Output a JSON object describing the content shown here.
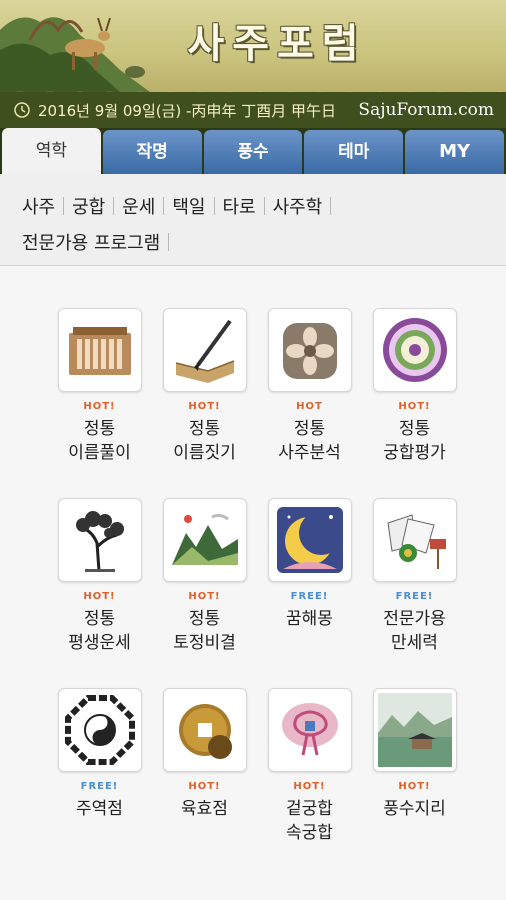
{
  "banner": {
    "title": "사주포럼"
  },
  "datebar": {
    "date": "2016년 9월 09일(금) -丙申年 丁酉月 甲午日",
    "site": "SajuForum.com"
  },
  "tabs": [
    {
      "label": "역학",
      "active": true
    },
    {
      "label": "작명",
      "active": false
    },
    {
      "label": "풍수",
      "active": false
    },
    {
      "label": "테마",
      "active": false
    },
    {
      "label": "MY",
      "active": false
    }
  ],
  "submenu": {
    "row1": [
      "사주",
      "궁합",
      "운세",
      "택일",
      "타로",
      "사주학"
    ],
    "row2": [
      "전문가용 프로그램"
    ]
  },
  "grid": [
    {
      "icon": "name-tablet-icon",
      "badge": "HOT!",
      "badge_type": "hot",
      "line1": "정통",
      "line2": "이름풀이"
    },
    {
      "icon": "brush-book-icon",
      "badge": "HOT!",
      "badge_type": "hot",
      "line1": "정통",
      "line2": "이름짓기"
    },
    {
      "icon": "flower-seal-icon",
      "badge": "HOT",
      "badge_type": "hot",
      "line1": "정통",
      "line2": "사주분석"
    },
    {
      "icon": "mandala-icon",
      "badge": "HOT!",
      "badge_type": "hot",
      "line1": "정통",
      "line2": "궁합평가"
    },
    {
      "icon": "tree-icon",
      "badge": "HOT!",
      "badge_type": "hot",
      "line1": "정통",
      "line2": "평생운세"
    },
    {
      "icon": "mountain-landscape-icon",
      "badge": "HOT!",
      "badge_type": "hot",
      "line1": "정통",
      "line2": "토정비결"
    },
    {
      "icon": "moon-icon",
      "badge": "FREE!",
      "badge_type": "free",
      "line1": "꿈해몽",
      "line2": ""
    },
    {
      "icon": "fans-icon",
      "badge": "FREE!",
      "badge_type": "free",
      "line1": "전문가용",
      "line2": "만세력"
    },
    {
      "icon": "bagua-icon",
      "badge": "FREE!",
      "badge_type": "free",
      "line1": "주역점",
      "line2": ""
    },
    {
      "icon": "coin-icon",
      "badge": "HOT!",
      "badge_type": "hot",
      "line1": "육효점",
      "line2": ""
    },
    {
      "icon": "knot-ornament-icon",
      "badge": "HOT!",
      "badge_type": "hot",
      "line1": "겉궁합",
      "line2": "속궁합"
    },
    {
      "icon": "house-landscape-icon",
      "badge": "HOT!",
      "badge_type": "hot",
      "line1": "풍수지리",
      "line2": ""
    }
  ]
}
